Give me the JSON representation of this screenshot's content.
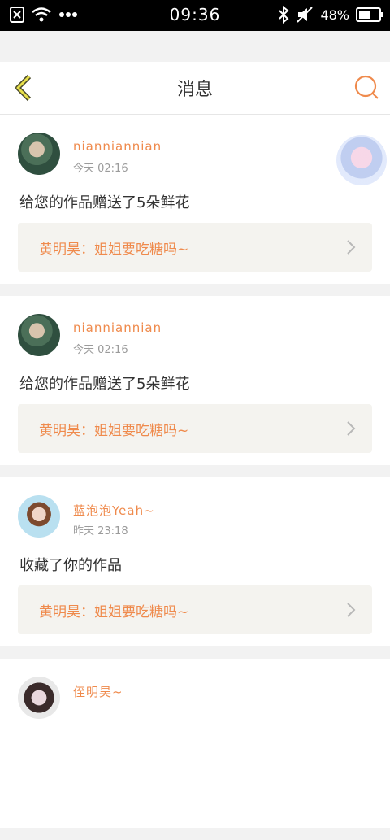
{
  "status": {
    "time": "09:36",
    "battery": "48%"
  },
  "nav": {
    "title": "消息"
  },
  "messages": [
    {
      "username": "nianniannian",
      "time": "今天 02:16",
      "content": "给您的作品赠送了5朵鲜花",
      "quote": "黄明昊：姐姐要吃糖吗~"
    },
    {
      "username": "nianniannian",
      "time": "今天 02:16",
      "content": "给您的作品赠送了5朵鲜花",
      "quote": "黄明昊：姐姐要吃糖吗~"
    },
    {
      "username": "蓝泡泡Yeah~",
      "time": "昨天 23:18",
      "content": "收藏了你的作品",
      "quote": "黄明昊：姐姐要吃糖吗~"
    },
    {
      "username": "侄明昊~",
      "time": "",
      "content": "",
      "quote": ""
    }
  ]
}
